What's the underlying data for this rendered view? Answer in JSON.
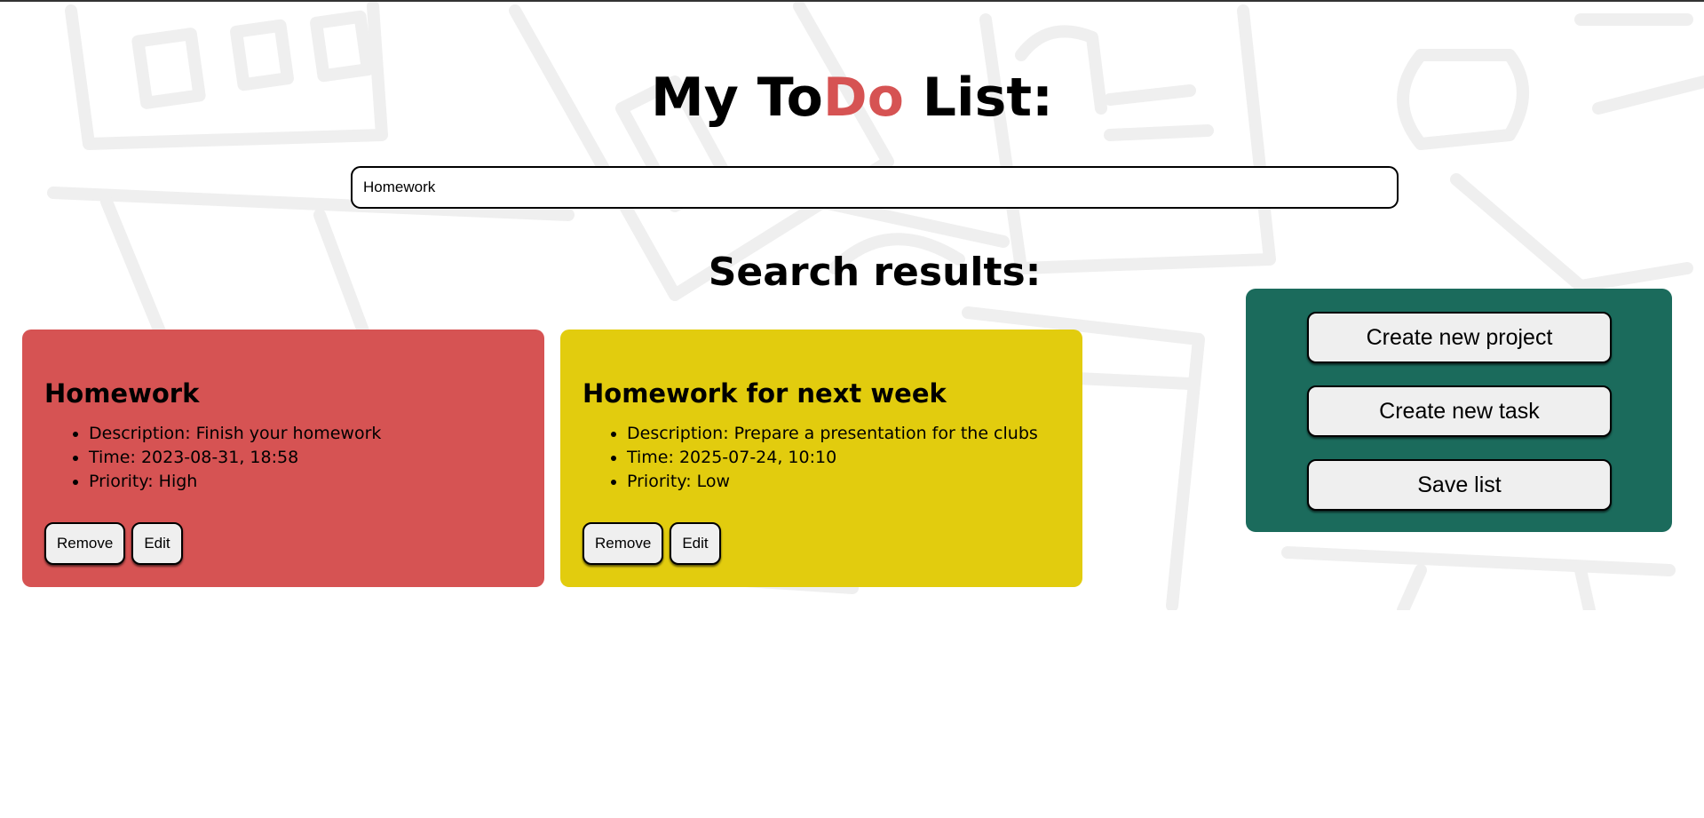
{
  "colors": {
    "accent": "#d65353",
    "high_priority_card": "#d65353",
    "low_priority_card": "#e2cc0e",
    "panel": "#1b6b5c",
    "button_bg": "#efefef"
  },
  "header": {
    "title_part1": "My To",
    "title_accent": "Do",
    "title_part2": " List:"
  },
  "search": {
    "value": "Homework"
  },
  "results": {
    "heading": "Search results:",
    "remove_label": "Remove",
    "edit_label": "Edit",
    "tasks": [
      {
        "title": "Homework",
        "description": "Description: Finish your homework",
        "time": "Time: 2023-08-31, 18:58",
        "priority": "Priority: High"
      },
      {
        "title": "Homework for next week",
        "description": "Description: Prepare a presentation for the clubs",
        "time": "Time: 2025-07-24, 10:10",
        "priority": "Priority: Low"
      }
    ]
  },
  "panel": {
    "create_project_label": "Create new project",
    "create_task_label": "Create new task",
    "save_label": "Save list"
  },
  "icons": {
    "background": "school-supplies-doodle-pattern"
  }
}
